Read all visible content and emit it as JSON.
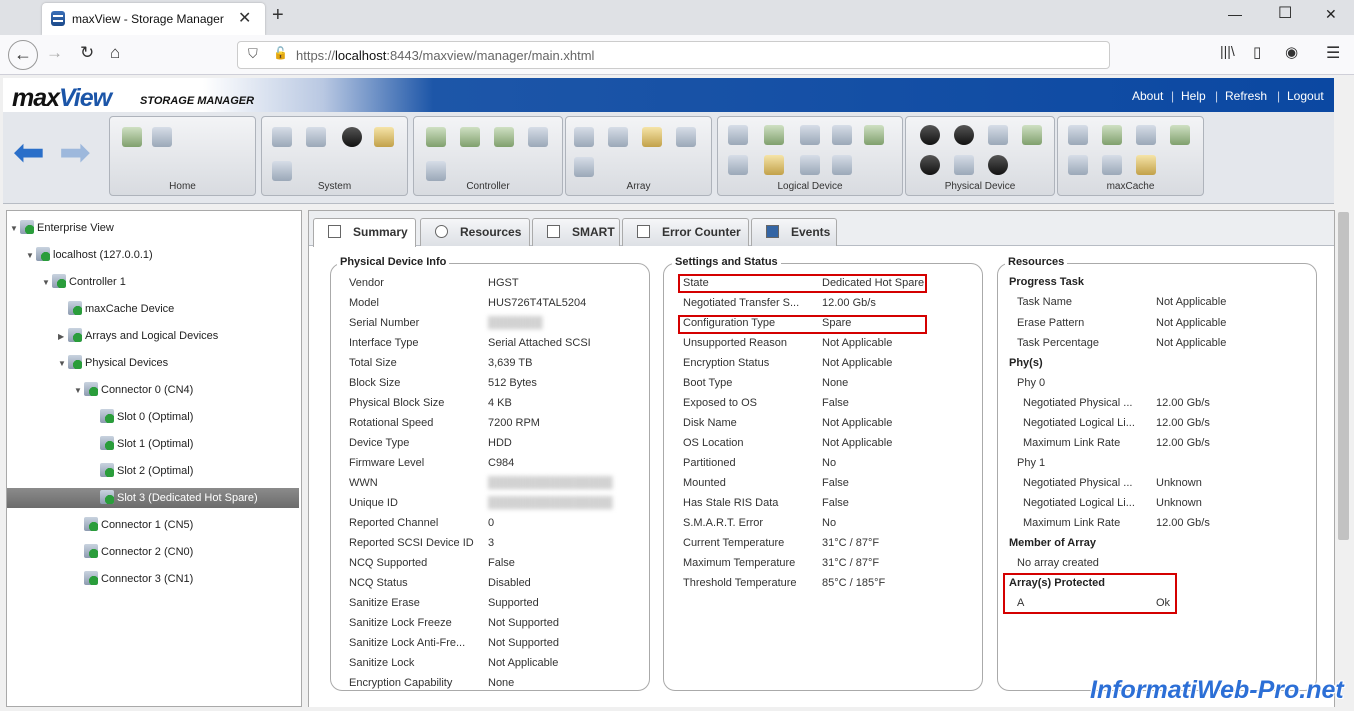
{
  "browser": {
    "tab_title": "maxView - Storage Manager",
    "url_prefix": "https://",
    "url_host": "localhost",
    "url_rest": ":8443/maxview/manager/main.xhtml"
  },
  "app": {
    "logo_main": "max",
    "logo_accent": "View",
    "logo_sub": "STORAGE MANAGER",
    "links": [
      "About",
      "Help",
      "Refresh",
      "Logout"
    ]
  },
  "toolbar": {
    "groups": [
      "Home",
      "System",
      "Controller",
      "Array",
      "Logical Device",
      "Physical Device",
      "maxCache"
    ]
  },
  "tree": [
    {
      "label": "Enterprise View",
      "level": 0,
      "expanded": "open"
    },
    {
      "label": "localhost (127.0.0.1)",
      "level": 1,
      "expanded": "open"
    },
    {
      "label": "Controller 1",
      "level": 2,
      "expanded": "open"
    },
    {
      "label": "maxCache Device",
      "level": 3,
      "expanded": "none"
    },
    {
      "label": "Arrays and Logical Devices",
      "level": 3,
      "expanded": "closed"
    },
    {
      "label": "Physical Devices",
      "level": 3,
      "expanded": "open"
    },
    {
      "label": "Connector 0 (CN4)",
      "level": 4,
      "expanded": "open"
    },
    {
      "label": "Slot 0 (Optimal)",
      "level": 5,
      "expanded": "none"
    },
    {
      "label": "Slot 1 (Optimal)",
      "level": 5,
      "expanded": "none"
    },
    {
      "label": "Slot 2 (Optimal)",
      "level": 5,
      "expanded": "none"
    },
    {
      "label": "Slot 3 (Dedicated Hot Spare)",
      "level": 5,
      "expanded": "none",
      "selected": true
    },
    {
      "label": "Connector 1 (CN5)",
      "level": 4,
      "expanded": "none"
    },
    {
      "label": "Connector 2 (CN0)",
      "level": 4,
      "expanded": "none"
    },
    {
      "label": "Connector 3 (CN1)",
      "level": 4,
      "expanded": "none"
    }
  ],
  "tabs": [
    "Summary",
    "Resources",
    "SMART",
    "Error Counter",
    "Events"
  ],
  "physical_info": {
    "title": "Physical Device Info",
    "rows": [
      [
        "Vendor",
        "HGST"
      ],
      [
        "Model",
        "HUS726T4TAL5204"
      ],
      [
        "Serial Number",
        "███████"
      ],
      [
        "Interface Type",
        "Serial Attached SCSI"
      ],
      [
        "Total Size",
        "3,639 TB"
      ],
      [
        "Block Size",
        "512 Bytes"
      ],
      [
        "Physical Block Size",
        "4 KB"
      ],
      [
        "Rotational Speed",
        "7200 RPM"
      ],
      [
        "Device Type",
        "HDD"
      ],
      [
        "Firmware Level",
        "C984"
      ],
      [
        "WWN",
        "████████████████"
      ],
      [
        "Unique ID",
        "████████████████"
      ],
      [
        "Reported Channel",
        "0"
      ],
      [
        "Reported SCSI Device ID",
        "3"
      ],
      [
        "NCQ Supported",
        "False"
      ],
      [
        "NCQ Status",
        "Disabled"
      ],
      [
        "Sanitize Erase",
        "Supported"
      ],
      [
        "Sanitize Lock Freeze",
        "Not Supported"
      ],
      [
        "Sanitize Lock Anti-Fre...",
        "Not Supported"
      ],
      [
        "Sanitize Lock",
        "Not Applicable"
      ],
      [
        "Encryption Capability",
        "None"
      ]
    ]
  },
  "settings": {
    "title": "Settings and Status",
    "rows": [
      [
        "State",
        "Dedicated Hot Spare"
      ],
      [
        "Negotiated Transfer S...",
        "12.00 Gb/s"
      ],
      [
        "Configuration Type",
        "Spare"
      ],
      [
        "Unsupported Reason",
        "Not Applicable"
      ],
      [
        "Encryption Status",
        "Not Applicable"
      ],
      [
        "Boot Type",
        "None"
      ],
      [
        "Exposed to OS",
        "False"
      ],
      [
        "Disk Name",
        "Not Applicable"
      ],
      [
        "OS Location",
        "Not Applicable"
      ],
      [
        "Partitioned",
        "No"
      ],
      [
        "Mounted",
        "False"
      ],
      [
        "Has Stale RIS Data",
        "False"
      ],
      [
        "S.M.A.R.T. Error",
        "No"
      ],
      [
        "Current Temperature",
        "31°C / 87°F"
      ],
      [
        "Maximum Temperature",
        "31°C / 87°F"
      ],
      [
        "Threshold Temperature",
        "85°C / 185°F"
      ]
    ]
  },
  "resources": {
    "title": "Resources",
    "progress_heading": "Progress Task",
    "progress": [
      [
        "Task Name",
        "Not Applicable"
      ],
      [
        "Erase Pattern",
        "Not Applicable"
      ],
      [
        "Task Percentage",
        "Not Applicable"
      ]
    ],
    "phys_heading": "Phy(s)",
    "phy0_label": "Phy 0",
    "phy0": [
      [
        "Negotiated Physical ...",
        "12.00 Gb/s"
      ],
      [
        "Negotiated Logical Li...",
        "12.00 Gb/s"
      ],
      [
        "Maximum Link Rate",
        "12.00 Gb/s"
      ]
    ],
    "phy1_label": "Phy 1",
    "phy1": [
      [
        "Negotiated Physical ...",
        "Unknown"
      ],
      [
        "Negotiated Logical Li...",
        "Unknown"
      ],
      [
        "Maximum Link Rate",
        "12.00 Gb/s"
      ]
    ],
    "member_heading": "Member of Array",
    "member_value": "No array created",
    "protected_heading": "Array(s) Protected",
    "protected_name": "A",
    "protected_status": "Ok"
  },
  "watermark": "InformatiWeb-Pro.net"
}
